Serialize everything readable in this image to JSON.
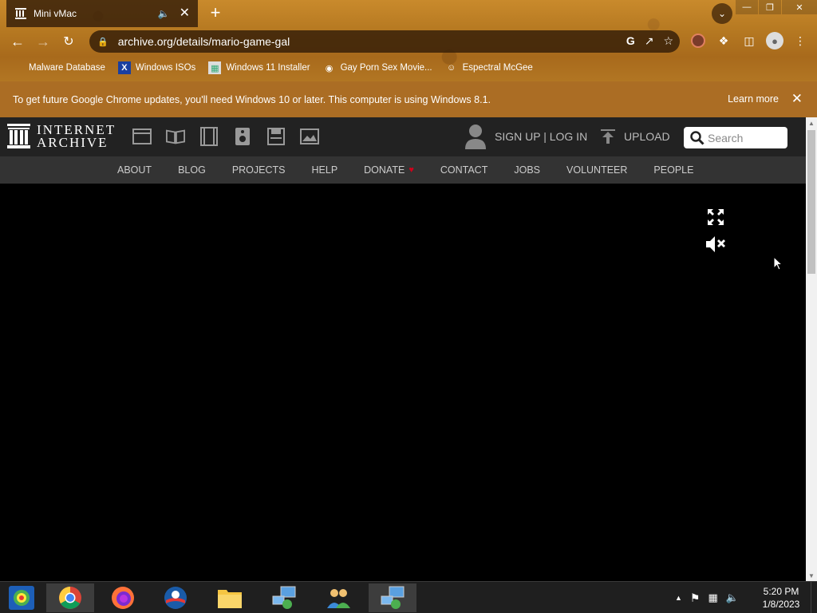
{
  "browser": {
    "tab": {
      "title": "Mini vMac"
    },
    "url": "archive.org/details/mario-game-gal",
    "bookmarks": [
      {
        "label": "Malware Database",
        "icon": "bookmark-icon"
      },
      {
        "label": "Windows ISOs",
        "icon": "x-logo-icon"
      },
      {
        "label": "Windows 11 Installer",
        "icon": "image-icon"
      },
      {
        "label": "Gay Porn Sex Movie...",
        "icon": "site-icon"
      },
      {
        "label": "Espectral McGee",
        "icon": "site-icon"
      }
    ],
    "infobar": {
      "message": "To get future Google Chrome updates, you'll need Windows 10 or later. This computer is using Windows 8.1.",
      "link": "Learn more"
    }
  },
  "archive": {
    "logo": {
      "line1": "INTERNET",
      "line2": "ARCHIVE"
    },
    "media_icons": [
      "web-icon",
      "texts-icon",
      "video-icon",
      "audio-icon",
      "software-icon",
      "images-icon"
    ],
    "auth": "SIGN UP | LOG IN",
    "upload": "UPLOAD",
    "search": {
      "placeholder": "Search"
    },
    "nav": [
      "ABOUT",
      "BLOG",
      "PROJECTS",
      "HELP",
      "DONATE",
      "CONTACT",
      "JOBS",
      "VOLUNTEER",
      "PEOPLE"
    ]
  },
  "taskbar": {
    "time": "5:20 PM",
    "date": "1/8/2023"
  },
  "colors": {
    "infobar": "#ab6d24",
    "header": "#222222",
    "nav": "#333333",
    "donate_heart": "#d0021b"
  }
}
